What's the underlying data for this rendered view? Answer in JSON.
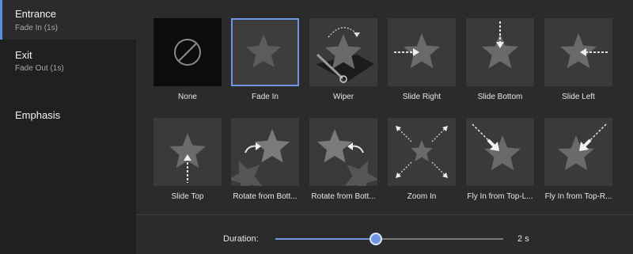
{
  "sidebar": {
    "items": [
      {
        "title": "Entrance",
        "subtitle": "Fade In (1s)",
        "active": true
      },
      {
        "title": "Exit",
        "subtitle": "Fade Out (1s)",
        "active": false
      },
      {
        "title": "Emphasis",
        "subtitle": "",
        "active": false
      }
    ]
  },
  "effects": [
    {
      "label": "None",
      "icon": "none-icon",
      "selected": false
    },
    {
      "label": "Fade In",
      "icon": "star-icon",
      "selected": true
    },
    {
      "label": "Wiper",
      "icon": "wiper-star-icon",
      "selected": false
    },
    {
      "label": "Slide Right",
      "icon": "slide-right-star-icon",
      "selected": false
    },
    {
      "label": "Slide Bottom",
      "icon": "slide-bottom-star-icon",
      "selected": false
    },
    {
      "label": "Slide Left",
      "icon": "slide-left-star-icon",
      "selected": false
    },
    {
      "label": "Slide Top",
      "icon": "slide-top-star-icon",
      "selected": false
    },
    {
      "label": "Rotate from Bott...",
      "icon": "rotate-bottom-left-star-icon",
      "selected": false
    },
    {
      "label": "Rotate from Bott...",
      "icon": "rotate-bottom-right-star-icon",
      "selected": false
    },
    {
      "label": "Zoom In",
      "icon": "zoom-in-star-icon",
      "selected": false
    },
    {
      "label": "Fly In from Top-L...",
      "icon": "fly-top-left-star-icon",
      "selected": false
    },
    {
      "label": "Fly In from Top-R...",
      "icon": "fly-top-right-star-icon",
      "selected": false
    }
  ],
  "duration": {
    "label": "Duration:",
    "value_text": "2 s",
    "slider_fraction": 0.44
  },
  "colors": {
    "accent": "#6f95e6",
    "sidebar_bg": "#202020",
    "panel_bg": "#2b2b2b",
    "tile_bg": "#3a3a3a"
  }
}
